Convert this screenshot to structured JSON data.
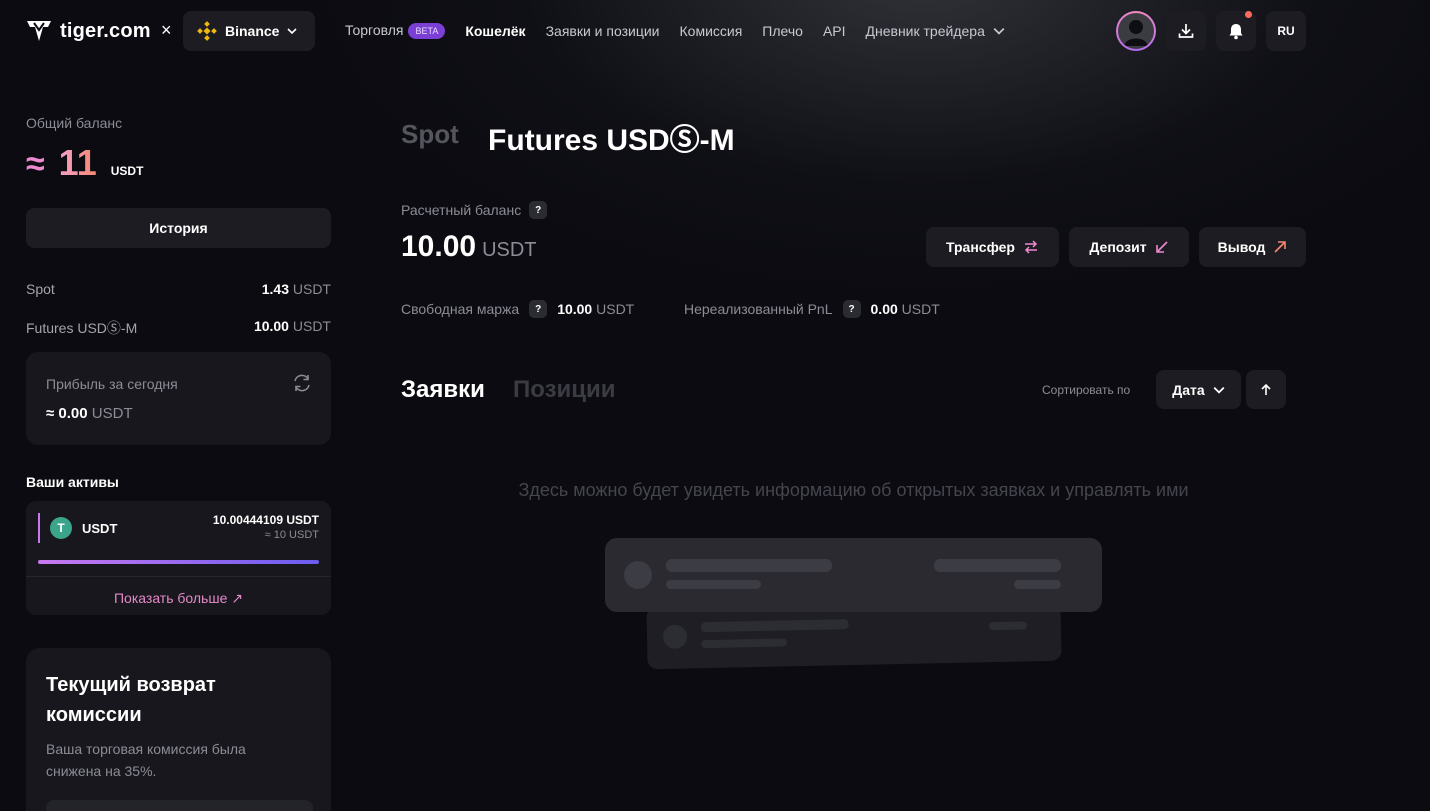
{
  "header": {
    "logo_text": "tiger.com",
    "separator": "×",
    "exchange": "Binance",
    "nav": [
      {
        "label": "Торговля",
        "badge": "BETA"
      },
      {
        "label": "Кошелёк",
        "active": true
      },
      {
        "label": "Заявки и позиции"
      },
      {
        "label": "Комиссия"
      },
      {
        "label": "Плечо"
      },
      {
        "label": "API"
      },
      {
        "label": "Дневник трейдера",
        "dropdown": true
      }
    ],
    "language": "RU",
    "icons": {
      "download": "download-icon",
      "bell": "bell-icon",
      "avatar": "user-avatar"
    }
  },
  "sidebar": {
    "total_label": "Общий баланс",
    "total_approx": "≈",
    "total_value": "11",
    "total_unit": "USDT",
    "history_button": "История",
    "balances": [
      {
        "name": "Spot",
        "value": "1.43",
        "unit": "USDT"
      },
      {
        "name": "Futures USDⓈ-M",
        "value": "10.00",
        "unit": "USDT"
      }
    ],
    "profit": {
      "label": "Прибыль за сегодня",
      "value": "≈ 0.00",
      "unit": "USDT"
    },
    "assets": {
      "title": "Ваши активы",
      "items": [
        {
          "symbol": "USDT",
          "icon_letter": "T",
          "amount": "10.00444109 USDT",
          "approx": "≈ 10 USDT",
          "share": 1.0
        }
      ],
      "show_more": "Показать больше ↗"
    },
    "cashback": {
      "title": "Текущий возврат комиссии",
      "description": "Ваша торговая комиссия была снижена на 35%."
    }
  },
  "main": {
    "tabs": {
      "spot": "Spot",
      "futures": "Futures USDⓈ-M"
    },
    "calc_balance_label": "Расчетный баланс",
    "help": "?",
    "calc_balance_value": "10.00",
    "calc_balance_unit": "USDT",
    "actions": {
      "transfer": "Трансфер",
      "deposit": "Депозит",
      "withdraw": "Вывод"
    },
    "free_margin": {
      "label": "Свободная маржа",
      "value": "10.00",
      "unit": "USDT"
    },
    "unrealized_pnl": {
      "label": "Нереализованный PnL",
      "value": "0.00",
      "unit": "USDT"
    },
    "list_tabs": {
      "orders": "Заявки",
      "positions": "Позиции"
    },
    "sort": {
      "label": "Сортировать по",
      "value": "Дата"
    },
    "empty_text": "Здесь можно будет увидеть информацию об открытых заявках и управлять ими"
  },
  "colors": {
    "background": "#0b0b11",
    "card": "#17171d",
    "button": "#1c1c22",
    "accent_pink": "#ee8ad0",
    "accent_purple": "#7b3fd6",
    "notification": "#ff6b5e",
    "tether_green": "#3aa58b"
  }
}
